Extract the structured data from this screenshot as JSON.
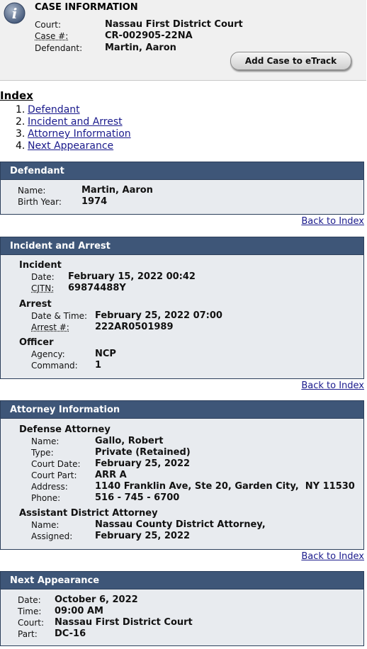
{
  "case": {
    "title": "CASE INFORMATION",
    "court_label": "Court:",
    "court": "Nassau First District Court",
    "case_no_label": "Case #:",
    "case_no": "CR-002905-22NA",
    "defendant_label": "Defendant:",
    "defendant": "Martin, Aaron",
    "etrack_button": "Add Case to eTrack"
  },
  "index": {
    "title": "Index",
    "items": [
      {
        "num": "1.",
        "label": "Defendant"
      },
      {
        "num": "2.",
        "label": "Incident and Arrest"
      },
      {
        "num": "3.",
        "label": "Attorney Information"
      },
      {
        "num": "4.",
        "label": "Next Appearance"
      }
    ]
  },
  "back_to_index": "Back to Index",
  "defendant_section": {
    "title": "Defendant",
    "name_label": "Name:",
    "name": "Martin, Aaron",
    "birth_label": "Birth Year:",
    "birth_year": "1974"
  },
  "incident_section": {
    "title": "Incident and Arrest",
    "incident_title": "Incident",
    "date_label": "Date:",
    "date": "February 15, 2022 00:42",
    "cjtn_label": "CJTN:",
    "cjtn": "69874488Y",
    "arrest_title": "Arrest",
    "datetime_label": "Date & Time:",
    "datetime": "February 25, 2022 07:00",
    "arrest_no_label": "Arrest #:",
    "arrest_no": "222AR0501989",
    "officer_title": "Officer",
    "agency_label": "Agency:",
    "agency": "NCP",
    "command_label": "Command:",
    "command": "1"
  },
  "attorney_section": {
    "title": "Attorney Information",
    "defense_title": "Defense Attorney",
    "name_label": "Name:",
    "name": "Gallo, Robert",
    "type_label": "Type:",
    "type": "Private (Retained)",
    "court_date_label": "Court Date:",
    "court_date": "February 25, 2022",
    "court_part_label": "Court Part:",
    "court_part": "ARR A",
    "address_label": "Address:",
    "address": "1140 Franklin Ave, Ste 20, Garden City,  NY 11530",
    "phone_label": "Phone:",
    "phone": "516 - 745 - 6700",
    "ada_title": "Assistant District Attorney",
    "ada_name_label": "Name:",
    "ada_name": "Nassau County District Attorney,",
    "assigned_label": "Assigned:",
    "assigned": "February 25, 2022"
  },
  "appearance_section": {
    "title": "Next Appearance",
    "date_label": "Date:",
    "date": "October 6, 2022",
    "time_label": "Time:",
    "time": "09:00 AM",
    "court_label": "Court:",
    "court": "Nassau First District Court",
    "part_label": "Part:",
    "part": "DC-16"
  }
}
